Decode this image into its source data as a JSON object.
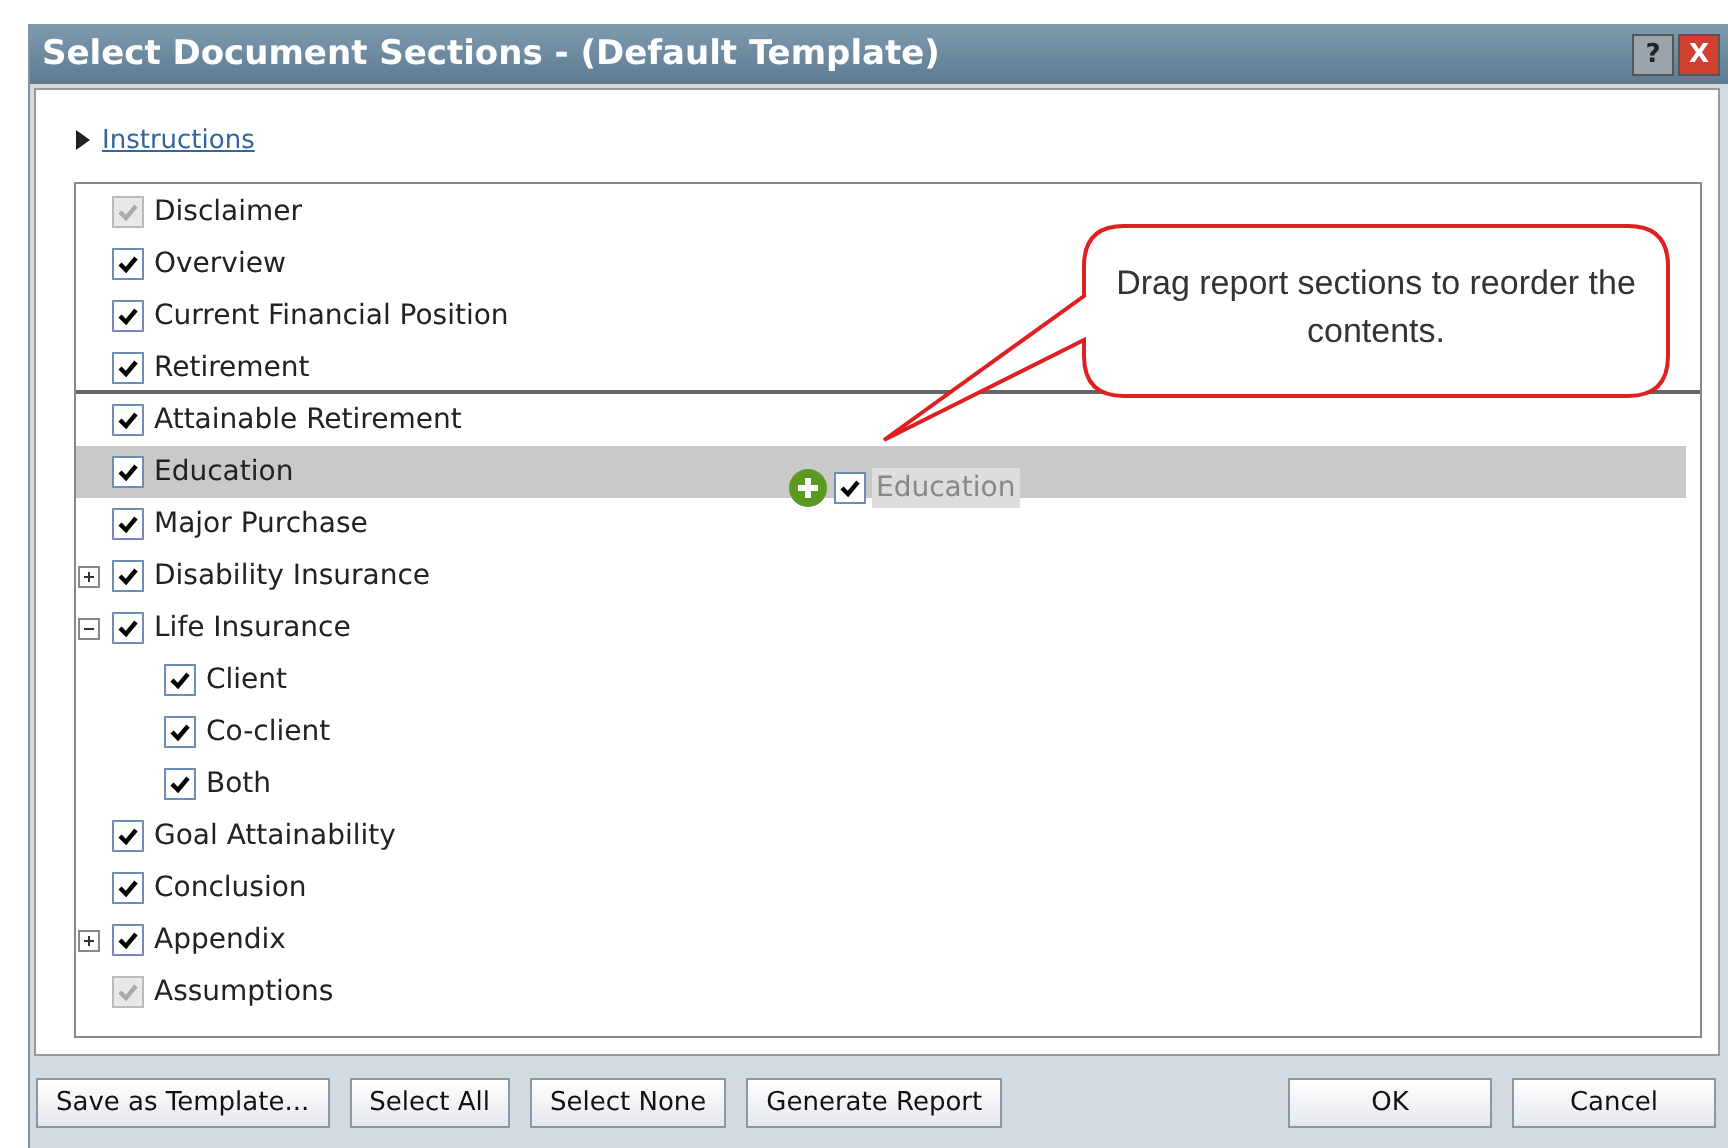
{
  "window": {
    "title": "Select Document Sections - (Default Template)",
    "help": "?",
    "close": "X"
  },
  "instructions": {
    "label": "Instructions",
    "expanded": false
  },
  "sections": [
    {
      "label": "Disclaimer",
      "checked": true,
      "disabled": true,
      "selected": false
    },
    {
      "label": "Overview",
      "checked": true,
      "disabled": false,
      "selected": false
    },
    {
      "label": "Current Financial Position",
      "checked": true,
      "disabled": false,
      "selected": false
    },
    {
      "label": "Retirement",
      "checked": true,
      "disabled": false,
      "selected": false,
      "drop_target": true
    },
    {
      "label": "Attainable Retirement",
      "checked": true,
      "disabled": false,
      "selected": false
    },
    {
      "label": "Education",
      "checked": true,
      "disabled": false,
      "selected": true
    },
    {
      "label": "Major Purchase",
      "checked": true,
      "disabled": false,
      "selected": false
    },
    {
      "label": "Disability Insurance",
      "checked": true,
      "disabled": false,
      "selected": false,
      "expanded": false
    },
    {
      "label": "Life Insurance",
      "checked": true,
      "disabled": false,
      "selected": false,
      "expanded": true,
      "children": [
        {
          "label": "Client",
          "checked": true,
          "disabled": false,
          "selected": false
        },
        {
          "label": "Co-client",
          "checked": true,
          "disabled": false,
          "selected": false
        },
        {
          "label": "Both",
          "checked": true,
          "disabled": false,
          "selected": false
        }
      ]
    },
    {
      "label": "Goal Attainability",
      "checked": true,
      "disabled": false,
      "selected": false
    },
    {
      "label": "Conclusion",
      "checked": true,
      "disabled": false,
      "selected": false
    },
    {
      "label": "Appendix",
      "checked": true,
      "disabled": false,
      "selected": false,
      "expanded": false
    },
    {
      "label": "Assumptions",
      "checked": true,
      "disabled": true,
      "selected": false
    }
  ],
  "drag_ghost": {
    "label": "Education",
    "checked": true
  },
  "callout": {
    "text": "Drag report sections to reorder the contents."
  },
  "buttons_left": [
    "Save as Template...",
    "Select All",
    "Select None",
    "Generate Report"
  ],
  "buttons_right": [
    "OK",
    "Cancel"
  ]
}
